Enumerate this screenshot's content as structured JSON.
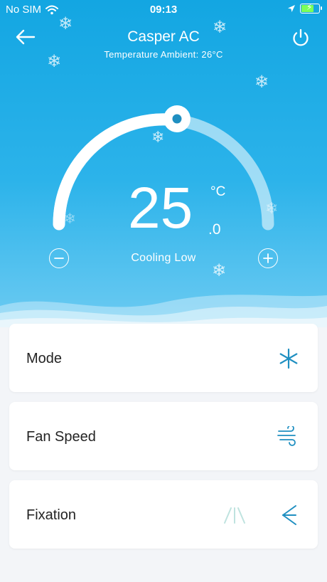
{
  "status_bar": {
    "carrier": "No SIM",
    "time": "09:13",
    "battery_level": 0.75,
    "battery_color": "#7bff59"
  },
  "header": {
    "title": "Casper AC",
    "subtitle": "Temperature Ambient: 26°C",
    "back_icon": "arrow-left-icon",
    "power_icon": "power-icon"
  },
  "thermostat": {
    "temperature": "25",
    "unit": "°C",
    "decimal": ".0",
    "mode_text": "Cooling  Low",
    "decrease_icon": "minus-circle-icon",
    "increase_icon": "plus-circle-icon"
  },
  "controls": [
    {
      "label": "Mode",
      "icon": "snowflake-icon"
    },
    {
      "label": "Fan Speed",
      "icon": "wind-icon"
    },
    {
      "label": "Fixation",
      "icon": "swing-direction-icon"
    }
  ],
  "colors": {
    "header_gradient_top": "#13a6e2",
    "accent": "#1f8fc1",
    "background": "#f3f5f8"
  }
}
